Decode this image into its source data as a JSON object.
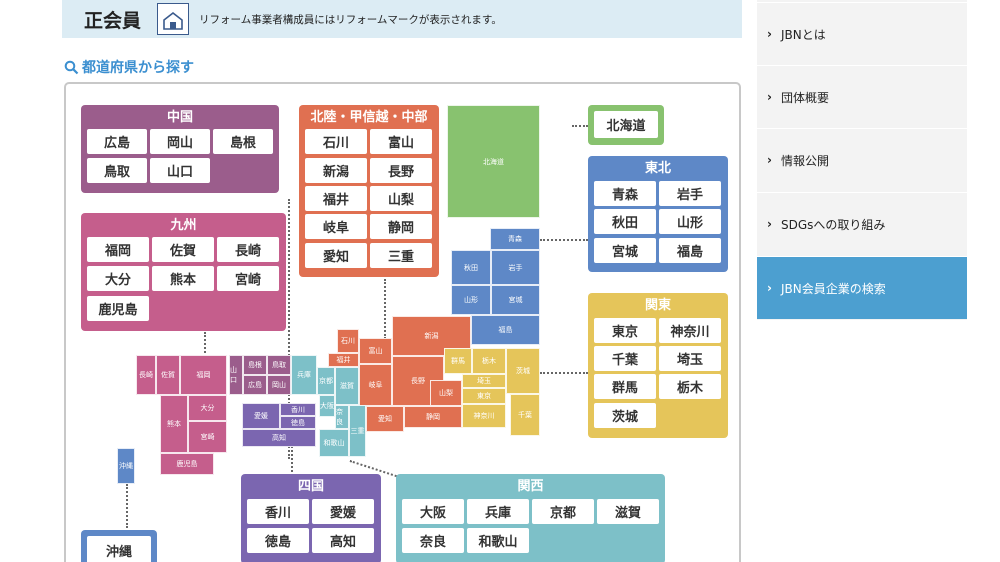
{
  "banner": {
    "title": "正会員",
    "note": "リフォーム事業者構成員にはリフォームマークが表示されます。"
  },
  "heading": "都道府県から探す",
  "regions": {
    "chugoku": {
      "title": "中国",
      "color": "#9b5d8c",
      "prefs": [
        "広島",
        "岡山",
        "島根",
        "鳥取",
        "山口"
      ]
    },
    "kyushu": {
      "title": "九州",
      "color": "#c55e8c",
      "prefs": [
        "福岡",
        "佐賀",
        "長崎",
        "大分",
        "熊本",
        "宮崎",
        "鹿児島"
      ]
    },
    "hokuriku": {
      "title": "北陸・甲信越・中部",
      "color": "#e07051",
      "prefs": [
        "石川",
        "富山",
        "新潟",
        "長野",
        "福井",
        "山梨",
        "岐阜",
        "静岡",
        "愛知",
        "三重"
      ]
    },
    "hokkaido": {
      "title": "北海道",
      "color": "#88c26f"
    },
    "tohoku": {
      "title": "東北",
      "color": "#5e88c7",
      "prefs": [
        "青森",
        "岩手",
        "秋田",
        "山形",
        "宮城",
        "福島"
      ]
    },
    "kanto": {
      "title": "関東",
      "color": "#e5c55a",
      "prefs": [
        "東京",
        "神奈川",
        "千葉",
        "埼玉",
        "群馬",
        "栃木",
        "茨城"
      ]
    },
    "shikoku": {
      "title": "四国",
      "color": "#7b66b0",
      "prefs": [
        "香川",
        "愛媛",
        "徳島",
        "高知"
      ]
    },
    "kansai": {
      "title": "関西",
      "color": "#7dc0c8",
      "prefs": [
        "大阪",
        "兵庫",
        "京都",
        "滋賀",
        "奈良",
        "和歌山"
      ]
    },
    "okinawa": {
      "title": "沖縄",
      "color": "#5e88c7"
    }
  },
  "map": {
    "hokkaido": "北海道",
    "aomori": "青森",
    "akita": "秋田",
    "iwate": "岩手",
    "yamagata": "山形",
    "miyagi": "宮城",
    "fukushima": "福島",
    "ishikawa": "石川",
    "fukui": "福井",
    "toyama": "富山",
    "niigata": "新潟",
    "gifu": "岐阜",
    "nagano": "長野",
    "yamanashi": "山梨",
    "aichi": "愛知",
    "shizuoka": "静岡",
    "gunma": "群馬",
    "tochigi": "栃木",
    "saitama": "埼玉",
    "ibaraki": "茨城",
    "tokyo": "東京",
    "kanagawa": "神奈川",
    "chiba": "千葉",
    "kyoto": "京都",
    "hyogo": "兵庫",
    "shiga": "滋賀",
    "osaka": "大阪",
    "nara": "奈良",
    "mie": "三重",
    "wakayama": "和歌山",
    "yamaguchi": "山口",
    "shimane": "島根",
    "tottori": "鳥取",
    "hiroshima": "広島",
    "okayama": "岡山",
    "ehime": "愛媛",
    "kagawa": "香川",
    "tokushima": "徳島",
    "kochi": "高知",
    "nagasaki": "長崎",
    "saga": "佐賀",
    "fukuoka": "福岡",
    "oita": "大分",
    "kumamoto": "熊本",
    "miyazaki": "宮崎",
    "kagoshima": "鹿児島",
    "okinawa": "沖縄"
  },
  "sidebar": {
    "items": [
      "JBNとは",
      "団体概要",
      "情報公開",
      "SDGsへの取り組み",
      "JBN会員企業の検索"
    ],
    "chevron": "›"
  }
}
